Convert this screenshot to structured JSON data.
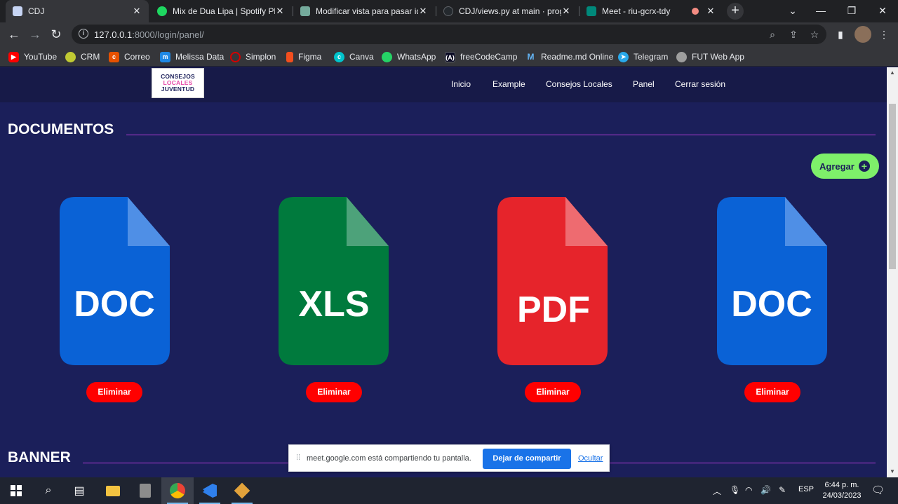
{
  "browser": {
    "tabs": [
      {
        "title": "CDJ",
        "color": "#c7d5f4",
        "active": true
      },
      {
        "title": "Mix de Dua Lipa | Spotify Play",
        "color": "#1ed760"
      },
      {
        "title": "Modificar vista para pasar id",
        "color": "#74aa9c"
      },
      {
        "title": "CDJ/views.py at main · progra",
        "color": "#24292e"
      },
      {
        "title": "Meet - riu-gcrx-tdy",
        "color": "#00897b"
      }
    ],
    "close_glyph": "✕",
    "new_tab_glyph": "+",
    "url_host": "127.0.0.1",
    "url_path": ":8000/login/panel/",
    "bookmarks": [
      {
        "label": "YouTube",
        "color": "#ff0000"
      },
      {
        "label": "CRM",
        "color": "#c0ca33"
      },
      {
        "label": "Correo",
        "color": "#e65100"
      },
      {
        "label": "Melissa Data",
        "color": "#1e88e5"
      },
      {
        "label": "Simplon",
        "color": "#d50000"
      },
      {
        "label": "Figma",
        "color": "#f24e1e"
      },
      {
        "label": "Canva",
        "color": "#00c4cc"
      },
      {
        "label": "WhatsApp",
        "color": "#25d366"
      },
      {
        "label": "freeCodeCamp",
        "color": "#0a0a23"
      },
      {
        "label": "Readme.md Online",
        "color": "#3f51b5"
      },
      {
        "label": "Telegram",
        "color": "#29a9eb"
      },
      {
        "label": "FUT Web App",
        "color": "#9e9e9e"
      }
    ]
  },
  "site": {
    "logo": {
      "line1": "CONSEJOS",
      "line2": "LOCALES",
      "line3": "JUVENTUD"
    },
    "nav": [
      "Inicio",
      "Example",
      "Consejos Locales",
      "Panel",
      "Cerrar sesión"
    ],
    "documents_title": "DOCUMENTOS",
    "add_label": "Agregar",
    "add_glyph": "+",
    "documents": [
      {
        "type": "DOC",
        "color": "#0a62d6",
        "fold": "#4f8fe6"
      },
      {
        "type": "XLS",
        "color": "#007a3d",
        "fold": "#4da27a"
      },
      {
        "type": "PDF",
        "color": "#e6242b",
        "fold": "#ee6b70"
      },
      {
        "type": "DOC",
        "color": "#0a62d6",
        "fold": "#4f8fe6"
      }
    ],
    "delete_label": "Eliminar",
    "banner_title": "BANNER"
  },
  "share_bar": {
    "grip": "⁞⁞",
    "message": "meet.google.com está compartiendo tu pantalla.",
    "stop_label": "Dejar de compartir",
    "hide_label": "Ocultar"
  },
  "taskbar": {
    "language": "ESP",
    "time": "6:44 p. m.",
    "date": "24/03/2023"
  },
  "colors": {
    "page_bg": "#1b1f5a",
    "nav_bg": "#171a48",
    "accent_line": "#b23ad6",
    "add_button": "#7ef06a",
    "delete_button": "#ff0000"
  }
}
